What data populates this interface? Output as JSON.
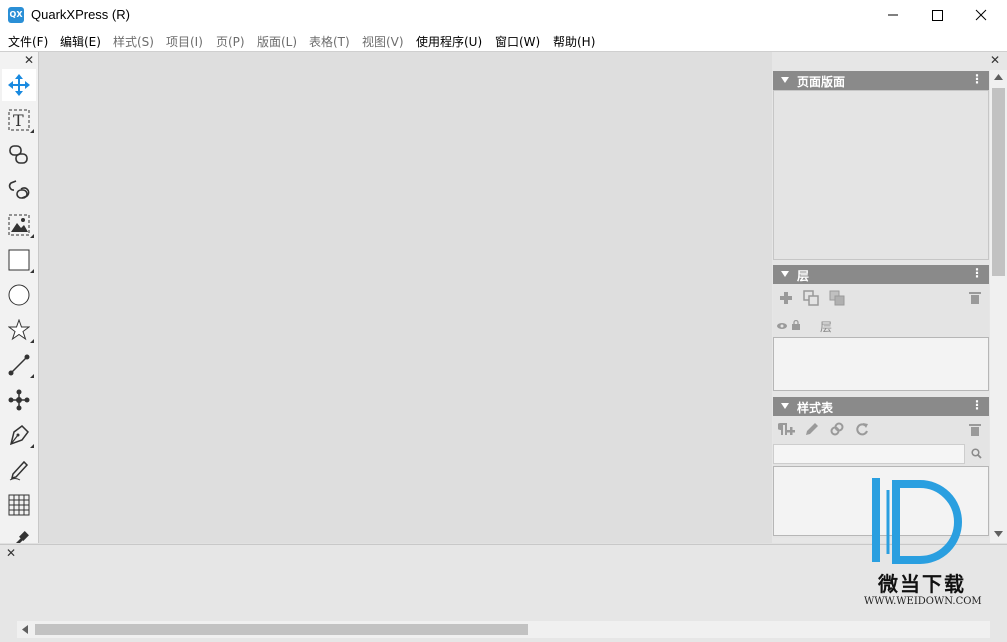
{
  "window": {
    "title": "QuarkXPress (R)",
    "app_icon_text": "QX",
    "controls": {
      "minimize": "—",
      "maximize": "☐",
      "close": "✕"
    }
  },
  "menu": [
    {
      "label": "文件(F)",
      "enabled": true
    },
    {
      "label": "编辑(E)",
      "enabled": true
    },
    {
      "label": "样式(S)",
      "enabled": false
    },
    {
      "label": "项目(I)",
      "enabled": false
    },
    {
      "label": "页(P)",
      "enabled": false
    },
    {
      "label": "版面(L)",
      "enabled": false
    },
    {
      "label": "表格(T)",
      "enabled": false
    },
    {
      "label": "视图(V)",
      "enabled": false
    },
    {
      "label": "使用程序(U)",
      "enabled": true
    },
    {
      "label": "窗口(W)",
      "enabled": true
    },
    {
      "label": "帮助(H)",
      "enabled": true
    }
  ],
  "toolbox": {
    "tools": [
      "move-tool",
      "text-tool",
      "link-tool",
      "unlink-tool",
      "picture-box-tool",
      "rectangle-box-tool",
      "oval-box-tool",
      "star-box-tool",
      "line-tool",
      "bezier-tool",
      "pen-tool",
      "freehand-tool",
      "table-tool",
      "eyedropper-tool"
    ],
    "selected": "move-tool"
  },
  "panels": {
    "page_layout": {
      "title": "页面版面"
    },
    "layers": {
      "title": "层",
      "row_label": "层"
    },
    "style_sheets": {
      "title": "样式表",
      "search_placeholder": ""
    }
  },
  "panel_menu_glyph": "⋮",
  "close_glyph": "✕",
  "watermark": {
    "brand": "微当下载",
    "url": "WWW.WEIDOWN.COM",
    "color": "#2a9fe0"
  },
  "colors": {
    "accent": "#2a8fd6",
    "panel_header": "#8a8a8a"
  }
}
